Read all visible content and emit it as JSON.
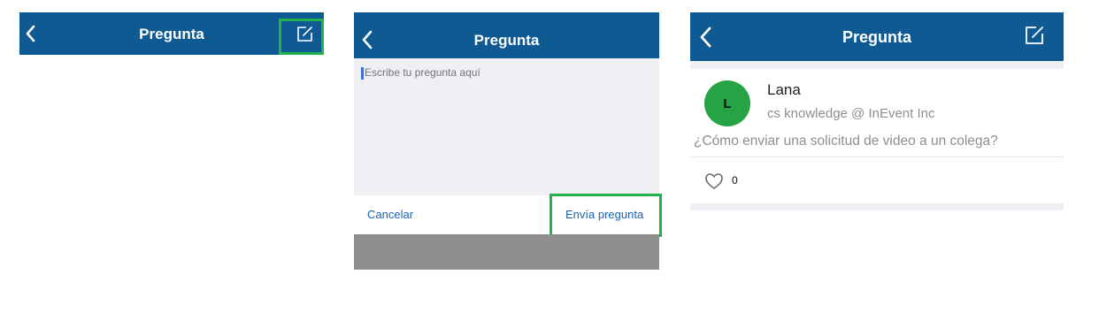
{
  "colors": {
    "navbar": "#0f5a92",
    "highlight": "#22b24c",
    "link": "#1a63b5",
    "avatar": "#27a346",
    "compose_bg": "#efeff4",
    "keyboard_bg": "#8f8f8f"
  },
  "icons": {
    "back": "chevron-left-icon",
    "compose": "compose-icon",
    "like": "heart-icon"
  },
  "panel1": {
    "nav": {
      "title": "Pregunta"
    }
  },
  "panel2": {
    "nav": {
      "title": "Pregunta"
    },
    "compose": {
      "placeholder": "Escribe tu pregunta aquí"
    },
    "actions": {
      "cancel_label": "Cancelar",
      "send_label": "Envía pregunta"
    }
  },
  "panel3": {
    "nav": {
      "title": "Pregunta"
    },
    "question": {
      "avatar_initial": "L",
      "author": "Lana",
      "subtitle": "cs knowledge @ InEvent Inc",
      "text": "¿Cómo enviar una solicitud de video a un colega?",
      "likes": "0"
    }
  }
}
